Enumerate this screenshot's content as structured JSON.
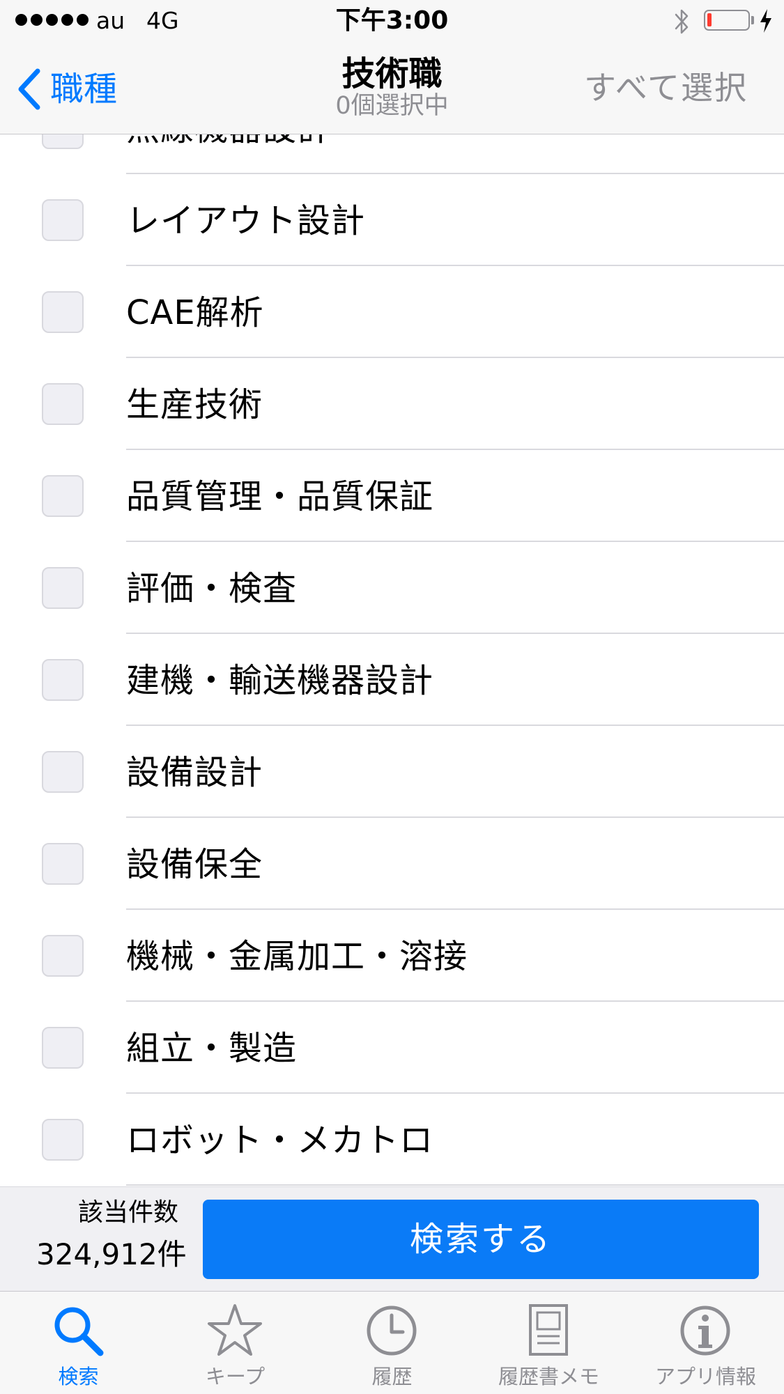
{
  "status_bar": {
    "carrier": "au",
    "network": "4G",
    "time": "下午3:00",
    "battery_level": 0.1
  },
  "nav": {
    "back_label": "職種",
    "title": "技術職",
    "subtitle": "0個選択中",
    "select_all_label": "すべて選択"
  },
  "list": {
    "items": [
      {
        "label": "無線機器設計",
        "checked": false
      },
      {
        "label": "レイアウト設計",
        "checked": false
      },
      {
        "label": "CAE解析",
        "checked": false
      },
      {
        "label": "生産技術",
        "checked": false
      },
      {
        "label": "品質管理・品質保証",
        "checked": false
      },
      {
        "label": "評価・検査",
        "checked": false
      },
      {
        "label": "建機・輸送機器設計",
        "checked": false
      },
      {
        "label": "設備設計",
        "checked": false
      },
      {
        "label": "設備保全",
        "checked": false
      },
      {
        "label": "機械・金属加工・溶接",
        "checked": false
      },
      {
        "label": "組立・製造",
        "checked": false
      },
      {
        "label": "ロボット・メカトロ",
        "checked": false
      }
    ]
  },
  "search_bar": {
    "count_label": "該当件数",
    "count_value": "324,912件",
    "button_label": "検索する"
  },
  "tab_bar": {
    "tabs": [
      {
        "label": "検索",
        "icon": "search-icon",
        "active": true
      },
      {
        "label": "キープ",
        "icon": "star-icon",
        "active": false
      },
      {
        "label": "履歴",
        "icon": "clock-icon",
        "active": false
      },
      {
        "label": "履歴書メモ",
        "icon": "document-icon",
        "active": false
      },
      {
        "label": "アプリ情報",
        "icon": "info-icon",
        "active": false
      }
    ]
  },
  "colors": {
    "accent": "#007aff",
    "search_button": "#0a7bf7",
    "inactive": "#8e8e93",
    "battery_low": "#ff3b30"
  }
}
